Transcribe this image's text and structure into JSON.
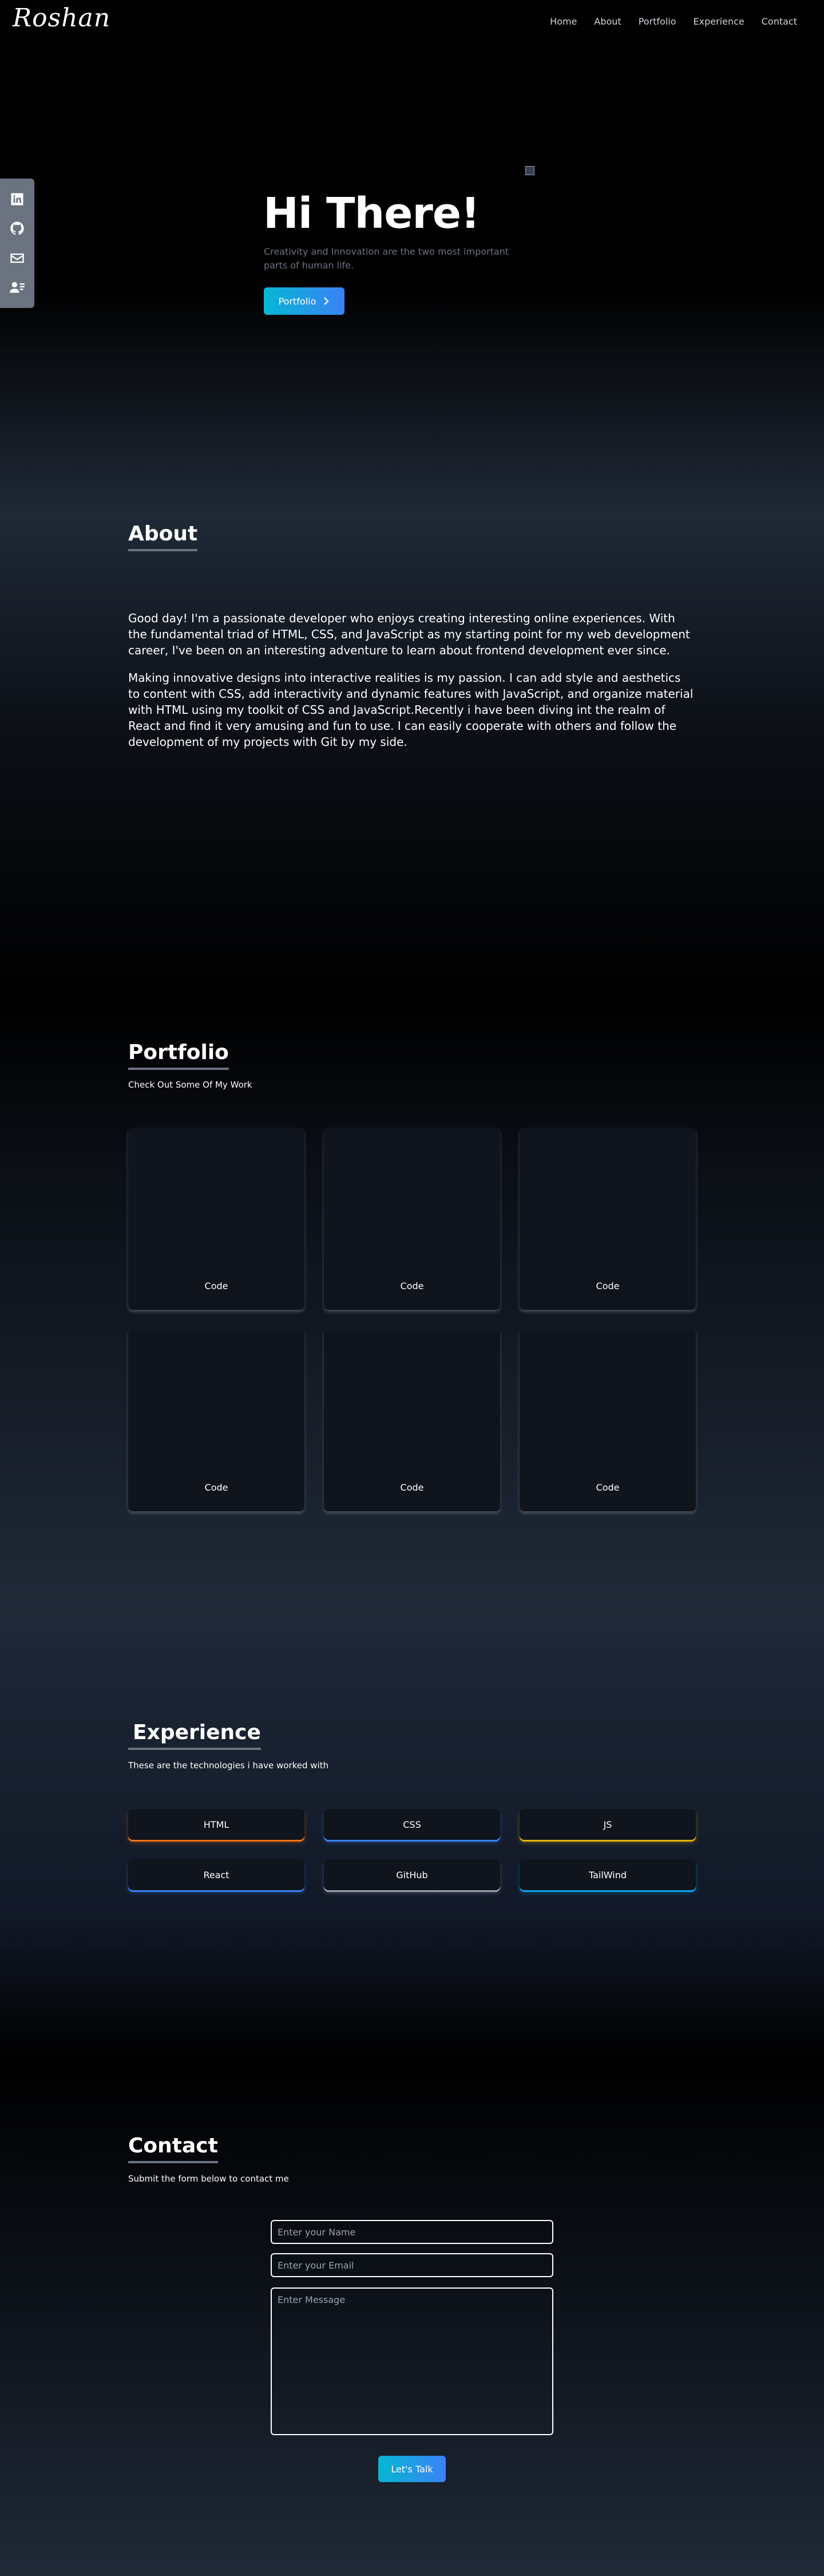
{
  "brand": {
    "logo": "Roshan"
  },
  "nav": {
    "items": [
      "Home",
      "About",
      "Portfolio",
      "Experience",
      "Contact"
    ]
  },
  "social": {
    "icons": [
      "linkedin-icon",
      "github-icon",
      "mail-icon",
      "resume-icon"
    ]
  },
  "hero": {
    "title": "Hi There!",
    "subtitle": "Creativity and Innovation are the two most important parts of human life.",
    "button_label": "Portfolio",
    "button_icon": "chevron-right-icon"
  },
  "about": {
    "title": "About",
    "paragraphs": [
      "Good day! I'm a passionate developer who enjoys creating interesting online experiences. With the fundamental triad of HTML, CSS, and JavaScript as my starting point for my web development career, I've been on an interesting adventure to learn about frontend development ever since.",
      "Making innovative designs into interactive realities is my passion. I can add style and aesthetics to content with CSS, add interactivity and dynamic features with JavaScript, and organize material with HTML using my toolkit of CSS and JavaScript.Recently i have been diving int the realm of React and find it very amusing and fun to use. I can easily cooperate with others and follow the development of my projects with Git by my side."
    ]
  },
  "portfolio": {
    "title": "Portfolio",
    "subtitle": "Check Out Some Of My Work",
    "cards": [
      {
        "label": "Code"
      },
      {
        "label": "Code"
      },
      {
        "label": "Code"
      },
      {
        "label": "Code"
      },
      {
        "label": "Code"
      },
      {
        "label": "Code"
      }
    ]
  },
  "experience": {
    "title": "Experience",
    "subtitle": "These are the technologies i have worked with",
    "items": [
      {
        "name": "HTML",
        "color": "#f97316"
      },
      {
        "name": "CSS",
        "color": "#3b82f6"
      },
      {
        "name": "JS",
        "color": "#eab308"
      },
      {
        "name": "React",
        "color": "#3b82f6"
      },
      {
        "name": "GitHub",
        "color": "#9ca3af"
      },
      {
        "name": "TailWind",
        "color": "#0ea5e9"
      }
    ]
  },
  "contact": {
    "title": "Contact",
    "subtitle": "Submit the form below to contact me",
    "name_placeholder": "Enter your Name",
    "email_placeholder": "Enter your Email",
    "message_placeholder": "Enter Message",
    "button_label": "Let's Talk"
  },
  "colors": {
    "accent_start": "#06b6d4",
    "accent_end": "#3b82f6",
    "sidebar": "#6b7280"
  }
}
